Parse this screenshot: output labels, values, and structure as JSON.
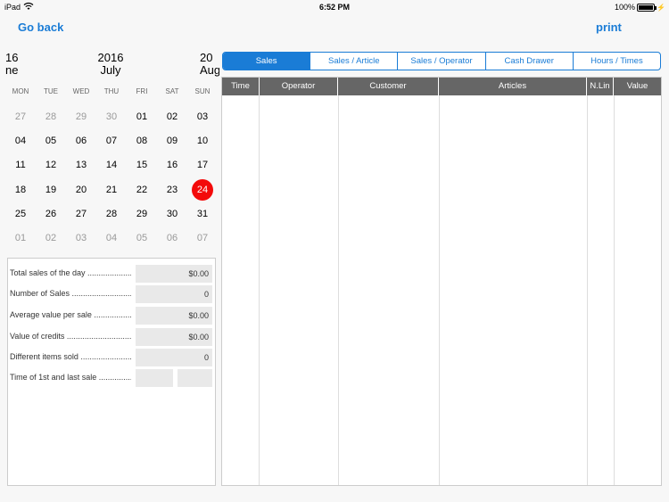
{
  "status_bar": {
    "device": "iPad",
    "time": "6:52 PM",
    "battery": "100%",
    "icons": [
      "wifi-icon",
      "battery-icon",
      "charging-icon"
    ]
  },
  "nav": {
    "back_label": "Go back",
    "print_label": "print"
  },
  "calendar": {
    "prev_month_day": "16",
    "prev_month_name": "ne",
    "year": "2016",
    "month": "July",
    "next_month_day": "20",
    "next_month_name": "Aug",
    "weekdays": [
      "MON",
      "TUE",
      "WED",
      "THU",
      "FRI",
      "SAT",
      "SUN"
    ],
    "selected_day": "24",
    "selected_color": "#f30a0a",
    "days": [
      {
        "d": "27",
        "other": true
      },
      {
        "d": "28",
        "other": true
      },
      {
        "d": "29",
        "other": true
      },
      {
        "d": "30",
        "other": true
      },
      {
        "d": "01",
        "other": false
      },
      {
        "d": "02",
        "other": false
      },
      {
        "d": "03",
        "other": false
      },
      {
        "d": "04",
        "other": false
      },
      {
        "d": "05",
        "other": false
      },
      {
        "d": "06",
        "other": false
      },
      {
        "d": "07",
        "other": false
      },
      {
        "d": "08",
        "other": false
      },
      {
        "d": "09",
        "other": false
      },
      {
        "d": "10",
        "other": false
      },
      {
        "d": "11",
        "other": false
      },
      {
        "d": "12",
        "other": false
      },
      {
        "d": "13",
        "other": false
      },
      {
        "d": "14",
        "other": false
      },
      {
        "d": "15",
        "other": false
      },
      {
        "d": "16",
        "other": false
      },
      {
        "d": "17",
        "other": false
      },
      {
        "d": "18",
        "other": false
      },
      {
        "d": "19",
        "other": false
      },
      {
        "d": "20",
        "other": false
      },
      {
        "d": "21",
        "other": false
      },
      {
        "d": "22",
        "other": false
      },
      {
        "d": "23",
        "other": false
      },
      {
        "d": "24",
        "other": false
      },
      {
        "d": "25",
        "other": false
      },
      {
        "d": "26",
        "other": false
      },
      {
        "d": "27",
        "other": false
      },
      {
        "d": "28",
        "other": false
      },
      {
        "d": "29",
        "other": false
      },
      {
        "d": "30",
        "other": false
      },
      {
        "d": "31",
        "other": false
      },
      {
        "d": "01",
        "other": true
      },
      {
        "d": "02",
        "other": true
      },
      {
        "d": "03",
        "other": true
      },
      {
        "d": "04",
        "other": true
      },
      {
        "d": "05",
        "other": true
      },
      {
        "d": "06",
        "other": true
      },
      {
        "d": "07",
        "other": true
      }
    ]
  },
  "stats": {
    "total_sales_label": "Total sales of the day ..........................",
    "total_sales_value": "$0.00",
    "number_sales_label": "Number of Sales ....................................",
    "number_sales_value": "0",
    "avg_value_label": "Average value per sale ...........................",
    "avg_value_value": "$0.00",
    "credits_label": "Value of credits .......................................",
    "credits_value": "$0.00",
    "items_label": "Different items sold .................................",
    "items_value": "0",
    "time_label": "Time of 1st and last sale ..........................",
    "first_time_value": "",
    "last_time_value": ""
  },
  "tabs": [
    {
      "label": "Sales",
      "active": true
    },
    {
      "label": "Sales / Article",
      "active": false
    },
    {
      "label": "Sales / Operator",
      "active": false
    },
    {
      "label": "Cash Drawer",
      "active": false
    },
    {
      "label": "Hours / Times",
      "active": false
    }
  ],
  "table": {
    "columns": [
      "Time",
      "Operator",
      "Customer",
      "Articles",
      "N.Lin",
      "Value"
    ],
    "rows": []
  },
  "colors": {
    "accent": "#1a7cd6",
    "header_bg": "#666666",
    "selected_day": "#f30a0a"
  }
}
